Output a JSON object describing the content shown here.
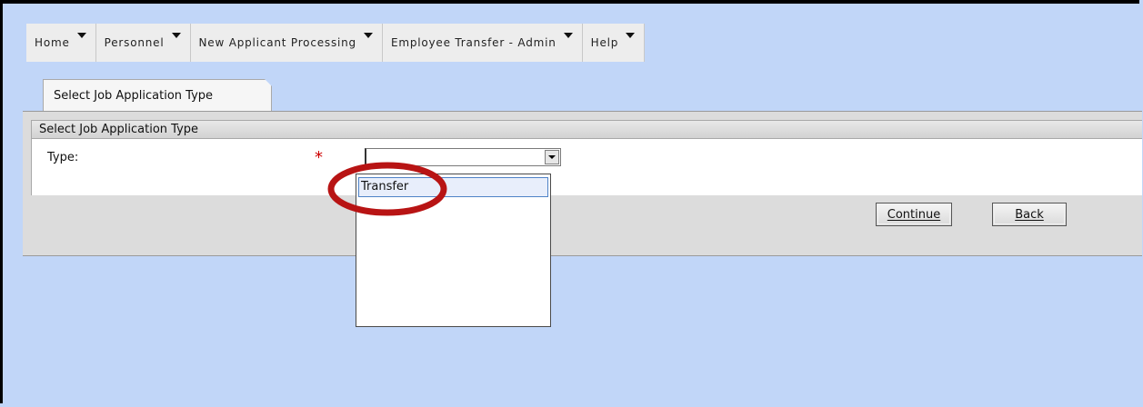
{
  "menu": [
    {
      "label": "Home",
      "icon": "caret-down-icon"
    },
    {
      "label": "Personnel",
      "icon": "caret-down-icon"
    },
    {
      "label": "New Applicant Processing",
      "icon": "caret-down-icon"
    },
    {
      "label": "Employee Transfer - Admin",
      "icon": "caret-down-icon"
    },
    {
      "label": "Help",
      "icon": "caret-down-icon"
    }
  ],
  "tab": {
    "label": "Select Job Application Type"
  },
  "panel": {
    "header": "Select Job Application Type",
    "type_label": "Type:",
    "required_marker": "*",
    "select_value": ""
  },
  "dropdown": {
    "options": [
      "Transfer"
    ]
  },
  "buttons": {
    "continue": "Continue",
    "back": "Back"
  },
  "colors": {
    "background": "#c1d6f8",
    "required": "#cc0000",
    "highlight_ellipse": "#b81414"
  }
}
